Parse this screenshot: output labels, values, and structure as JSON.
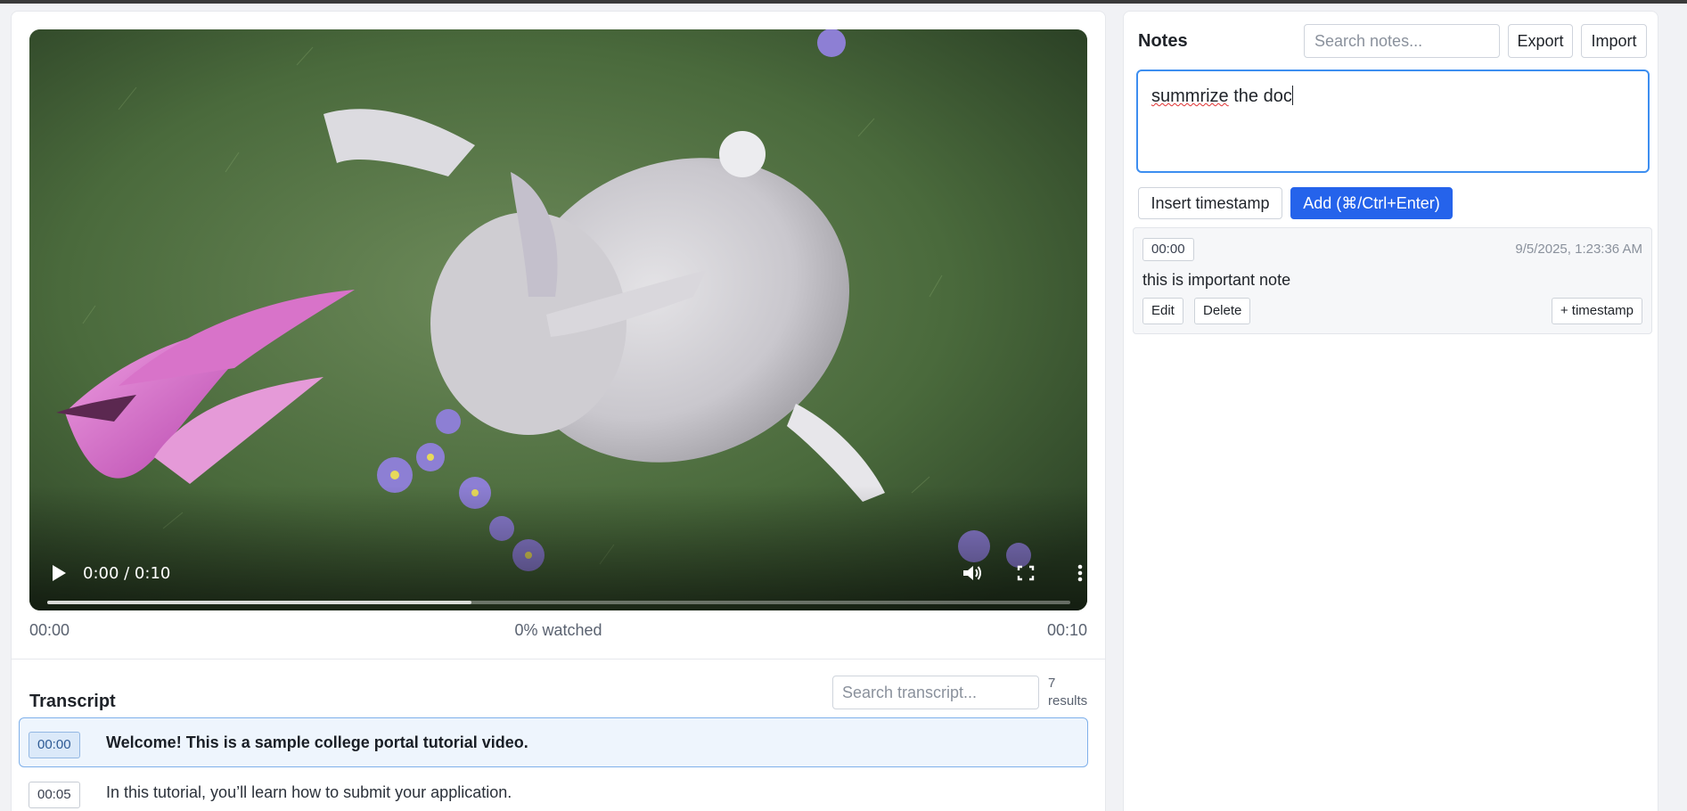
{
  "video": {
    "time_display": "0:00 / 0:10",
    "buffered_fraction": 0.415,
    "start_time": "00:00",
    "end_time": "00:10",
    "watched_label": "0% watched"
  },
  "transcript": {
    "title": "Transcript",
    "search_placeholder": "Search transcript...",
    "results_count": "7 results",
    "rows": [
      {
        "stamp": "00:00",
        "text": "Welcome! This is a sample college portal tutorial video.",
        "active": true
      },
      {
        "stamp": "00:05",
        "text": "In this tutorial, you’ll learn how to submit your application.",
        "active": false
      }
    ]
  },
  "notes": {
    "title": "Notes",
    "search_placeholder": "Search notes...",
    "export_label": "Export",
    "import_label": "Import",
    "draft": {
      "misspelled": "summrize",
      "rest": " the doc"
    },
    "insert_timestamp_label": "Insert timestamp",
    "add_label": "Add (⌘/Ctrl+Enter)",
    "items": [
      {
        "stamp": "00:00",
        "date": "9/5/2025, 1:23:36 AM",
        "text": "this is important note",
        "edit_label": "Edit",
        "delete_label": "Delete",
        "timestamp_label": "+ timestamp"
      }
    ]
  },
  "colors": {
    "accent": "#2563eb",
    "focus_ring": "#3d8ef0",
    "active_row_bg": "#eef5fd"
  }
}
